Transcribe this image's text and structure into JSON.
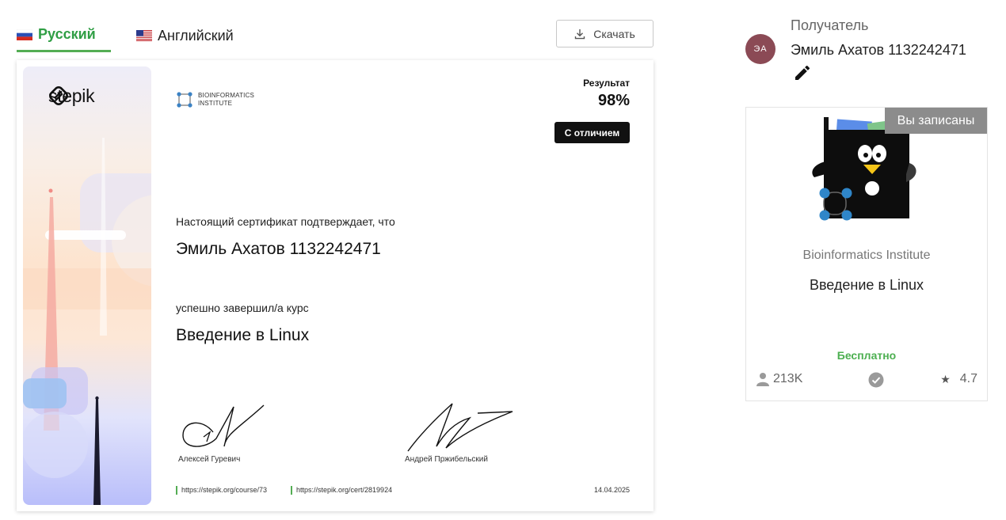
{
  "tabs": [
    {
      "label": "Русский",
      "active": true
    },
    {
      "label": "Английский",
      "active": false
    }
  ],
  "download_label": "Скачать",
  "certificate": {
    "brand": "stepik",
    "issuer_line1": "BIOINFORMATICS",
    "issuer_line2": "INSTITUTE",
    "result_label": "Результат",
    "result_value": "98%",
    "honors": "С отличием",
    "confirm_text": "Настоящий сертификат подтверждает, что",
    "recipient": "Эмиль Ахатов 1132242471",
    "completed_text": "успешно завершил/а  курс",
    "course": "Введение в Linux",
    "signer_1": "Алексей Гуревич",
    "signer_2": "Андрей Пржибельский",
    "course_url": "https://stepik.org/course/73",
    "cert_url": "https://stepik.org/cert/2819924",
    "date": "14.04.2025"
  },
  "recipient_panel": {
    "label": "Получатель",
    "avatar_initials": "ЭА",
    "name": "Эмиль Ахатов 1132242471"
  },
  "course_card": {
    "badge": "Вы записаны",
    "org": "Bioinformatics Institute",
    "title": "Введение в Linux",
    "price": "Бесплатно",
    "learners": "213K",
    "rating": "4.7"
  },
  "colors": {
    "accent_green": "#54ad54",
    "avatar_bg": "#8b4a55",
    "badge_bg": "#8c8c8c"
  },
  "icons": [
    "flag-ru-icon",
    "flag-us-icon",
    "download-icon",
    "stepik-logo-icon",
    "bioinformatics-logo-icon",
    "pencil-icon",
    "person-icon",
    "check-circle-icon",
    "star-icon"
  ]
}
